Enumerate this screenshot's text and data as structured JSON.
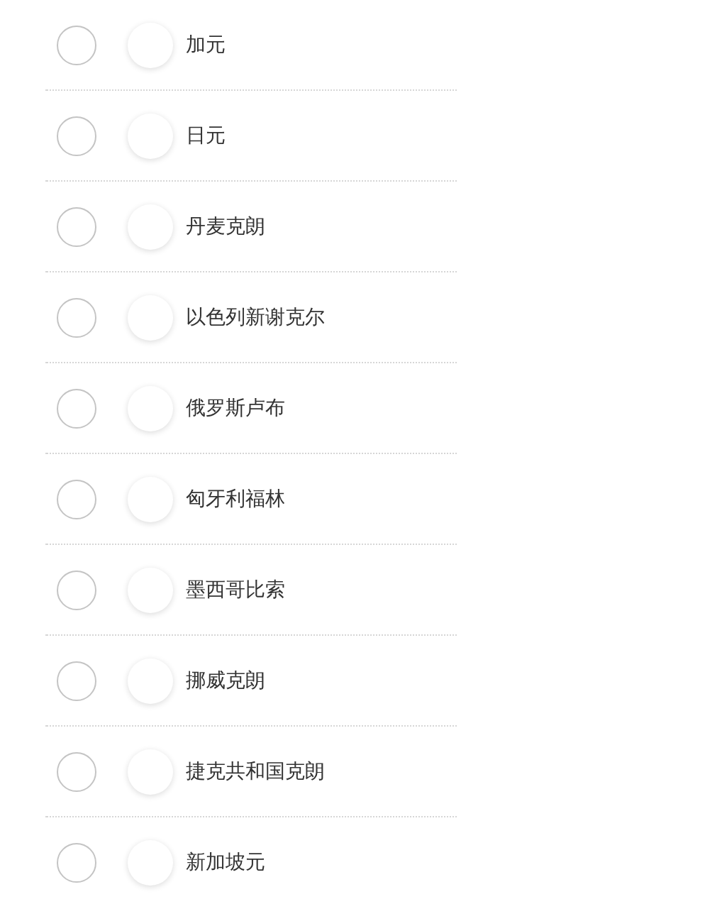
{
  "currencies": [
    {
      "name": "加元",
      "selected": false
    },
    {
      "name": "日元",
      "selected": false
    },
    {
      "name": "丹麦克朗",
      "selected": false
    },
    {
      "name": "以色列新谢克尔",
      "selected": false
    },
    {
      "name": "俄罗斯卢布",
      "selected": false
    },
    {
      "name": "匈牙利福林",
      "selected": false
    },
    {
      "name": "墨西哥比索",
      "selected": false
    },
    {
      "name": "挪威克朗",
      "selected": false
    },
    {
      "name": "捷克共和国克朗",
      "selected": false
    },
    {
      "name": "新加坡元",
      "selected": false
    }
  ]
}
